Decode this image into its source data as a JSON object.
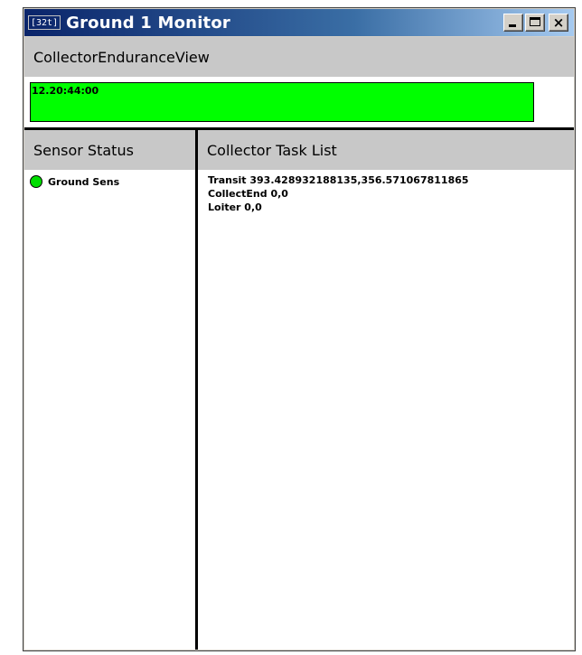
{
  "window": {
    "icon_text": "[32t]",
    "title": "Ground 1 Monitor",
    "close_glyph": "×"
  },
  "endurance": {
    "header": "CollectorEnduranceView",
    "time": "12.20:44:00",
    "fill_percent": 100,
    "fill_color": "#00ff00"
  },
  "sensor_status": {
    "header": "Sensor Status",
    "items": [
      {
        "name": "Ground Sens",
        "status_color": "#00dd00"
      }
    ]
  },
  "task_list": {
    "header": "Collector Task List",
    "items": [
      "Transit 393.428932188135,356.571067811865",
      "CollectEnd 0,0",
      "Loiter 0,0"
    ]
  }
}
